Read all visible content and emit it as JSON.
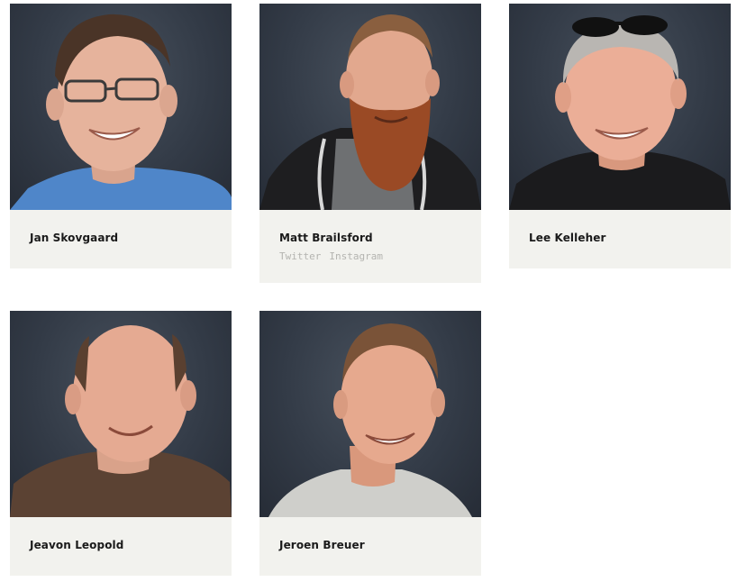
{
  "team": [
    {
      "name": "Jan Skovgaard",
      "links": []
    },
    {
      "name": "Matt Brailsford",
      "links": [
        "Twitter",
        "Instagram"
      ]
    },
    {
      "name": "Lee Kelleher",
      "links": []
    },
    {
      "name": "Jeavon Leopold",
      "links": []
    },
    {
      "name": "Jeroen Breuer",
      "links": []
    }
  ]
}
